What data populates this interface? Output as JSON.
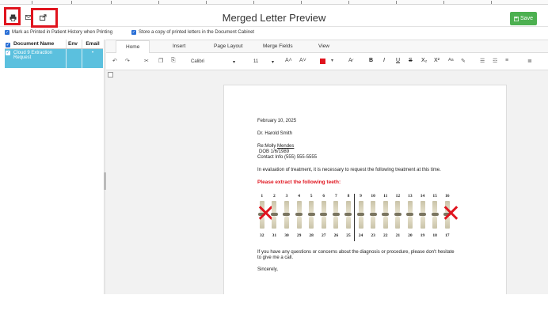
{
  "window": {
    "title": "Merged Letter Preview"
  },
  "header": {
    "print_icon": "printer-icon",
    "envelope_icon": "envelope-icon",
    "export_icon": "export-icon",
    "save_label": "Save",
    "save_icon": "save-icon"
  },
  "options": {
    "mark_printed": "Mark as Printed in Patient History when Printing",
    "store_copy": "Store a copy of printed letters in the Document Cabinet"
  },
  "documents": {
    "columns": [
      "Document Name",
      "Env",
      "Email"
    ],
    "rows": [
      {
        "name": "Cloud 9 Extraction Request",
        "env": "",
        "email": "•"
      }
    ]
  },
  "editor": {
    "tabs": [
      "Home",
      "Insert",
      "Page Layout",
      "Merge Fields",
      "View"
    ],
    "active_tab": "Home",
    "font": "Calibri",
    "font_size": "11",
    "font_color": "#e0141e",
    "toolbar": {
      "undo": "↶",
      "redo": "↷",
      "cut": "✂",
      "copy": "❐",
      "paste": "⎘",
      "grow": "A˄",
      "shrink": "A˅",
      "bold": "B",
      "italic": "I",
      "underline": "U",
      "strike": "S",
      "subscript": "X₂",
      "superscript": "X²",
      "case": "Aa",
      "bullets": "☰",
      "numbering": "☲",
      "outdent": "≡",
      "more": "≣"
    }
  },
  "letter": {
    "date": "February 10, 2025",
    "doctor": "Dr. Harold Smith",
    "re_prefix": "Re:Molly ",
    "re_name": "Mendes",
    "dob": "DOB 1/6/1989",
    "contact": "Contact Info (555) 555-5555",
    "intro": "In evaluation of  treatment, it is necessary to request the following treatment at this time.",
    "heading": "Please extract the following teeth:",
    "upper_numbers": [
      "1",
      "2",
      "3",
      "4",
      "5",
      "6",
      "7",
      "8",
      "9",
      "10",
      "11",
      "12",
      "13",
      "14",
      "15",
      "16"
    ],
    "lower_numbers": [
      "32",
      "31",
      "30",
      "29",
      "28",
      "27",
      "26",
      "25",
      "24",
      "23",
      "22",
      "21",
      "20",
      "19",
      "18",
      "17"
    ],
    "extract_teeth": [
      1,
      16
    ],
    "closing1": "If you have any questions or concerns about the diagnosis or procedure, please don't hesitate",
    "closing2": "to give me a call.",
    "signoff": "Sincerely,"
  }
}
